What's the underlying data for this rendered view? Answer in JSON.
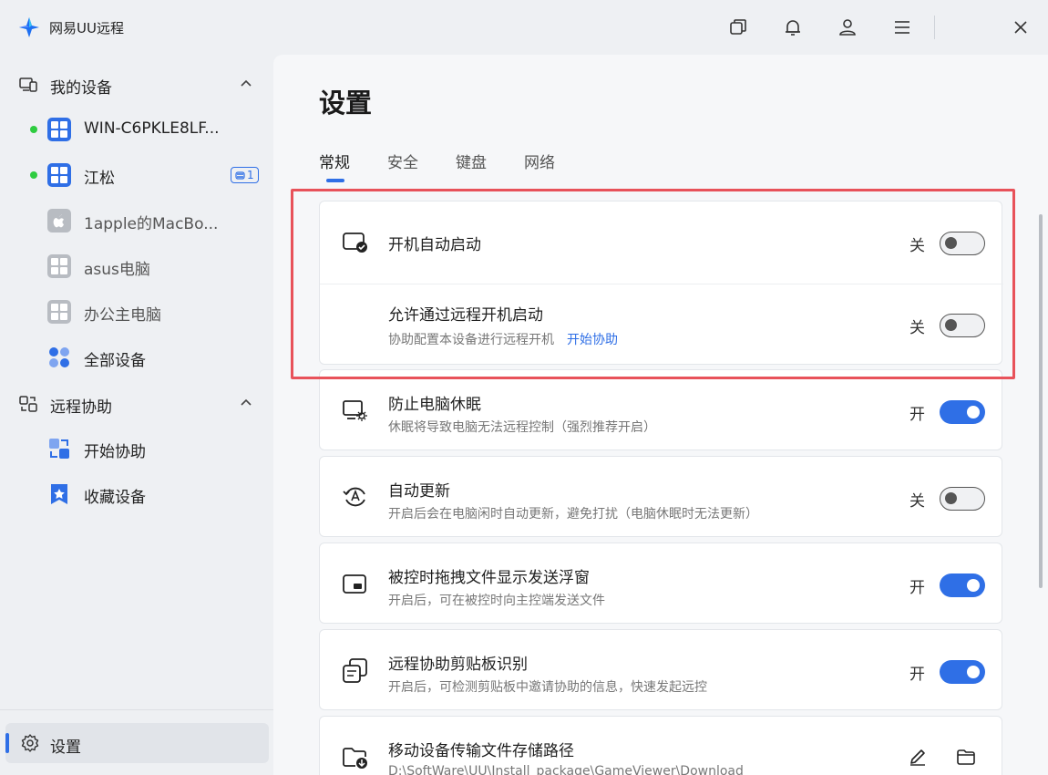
{
  "app": {
    "title": "网易UU远程"
  },
  "sidebar": {
    "my_devices": {
      "label": "我的设备",
      "items": [
        {
          "label": "WIN-C6PKLE8LF...",
          "online": true,
          "kind": "windows"
        },
        {
          "label": "江松",
          "online": true,
          "kind": "windows",
          "badge": "1"
        },
        {
          "label": "1apple的MacBo...",
          "online": false,
          "kind": "apple"
        },
        {
          "label": "asus电脑",
          "online": false,
          "kind": "windows"
        },
        {
          "label": "办公主电脑",
          "online": false,
          "kind": "windows"
        },
        {
          "label": "全部设备",
          "kind": "all"
        }
      ]
    },
    "remote_assist": {
      "label": "远程协助",
      "items": [
        {
          "label": "开始协助"
        },
        {
          "label": "收藏设备"
        }
      ]
    },
    "settings_label": "设置"
  },
  "main": {
    "title": "设置",
    "tabs": [
      {
        "label": "常规",
        "active": true
      },
      {
        "label": "安全",
        "active": false
      },
      {
        "label": "键盘",
        "active": false
      },
      {
        "label": "网络",
        "active": false
      }
    ],
    "settings": [
      {
        "title": "开机自动启动",
        "state": "关",
        "on": false,
        "icon": "monitor-check-icon"
      },
      {
        "title": "允许通过远程开机启动",
        "desc": "协助配置本设备进行远程开机",
        "link": "开始协助",
        "state": "关",
        "on": false
      },
      {
        "title": "防止电脑休眠",
        "desc": "休眠将导致电脑无法远程控制（强烈推荐开启）",
        "state": "开",
        "on": true,
        "icon": "monitor-sun-icon"
      },
      {
        "title": "自动更新",
        "desc": "开启后会在电脑闲时自动更新，避免打扰（电脑休眠时无法更新）",
        "state": "关",
        "on": false,
        "icon": "auto-update-icon"
      },
      {
        "title": "被控时拖拽文件显示发送浮窗",
        "desc": "开启后，可在被控时向主控端发送文件",
        "state": "开",
        "on": true,
        "icon": "floating-window-icon"
      },
      {
        "title": "远程协助剪贴板识别",
        "desc": "开启后，可检测剪贴板中邀请协助的信息，快速发起远控",
        "state": "开",
        "on": true,
        "icon": "clipboard-icon"
      },
      {
        "title": "移动设备传输文件存储路径",
        "desc": "D:\\SoftWare\\UU\\Install_package\\GameViewer\\Download",
        "icon": "folder-download-icon"
      }
    ]
  },
  "colors": {
    "accent": "#2f6fe6",
    "online": "#2ecc40",
    "highlight": "#e8525a"
  }
}
